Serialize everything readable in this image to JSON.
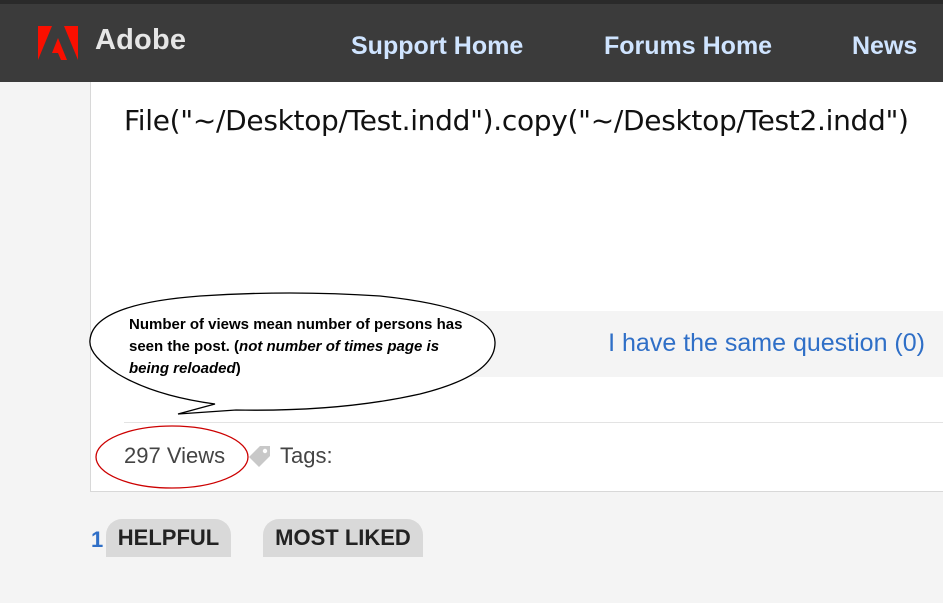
{
  "header": {
    "brand": "Adobe",
    "nav": [
      "Support Home",
      "Forums Home",
      "News"
    ]
  },
  "post": {
    "code_line": "File(\"~/Desktop/Test.indd\").copy(\"~/Desktop/Test2.indd\")",
    "same_question": "I have the same question (0)",
    "views": "297 Views",
    "tags_label": "Tags:"
  },
  "annotation": {
    "text_bold": "Number of views mean number of persons has seen the post. (",
    "text_italic": "not number of times page is being reloaded",
    "text_end": ")"
  },
  "sort": {
    "count": "1",
    "tabs": [
      "HELPFUL",
      "MOST LIKED"
    ]
  },
  "colors": {
    "nav_bg": "#3b3b3b",
    "nav_link": "#cfe4ff",
    "adobe_red": "#fa0f00",
    "link_blue": "#2f6fc7",
    "annotation_red": "#cc0000"
  }
}
